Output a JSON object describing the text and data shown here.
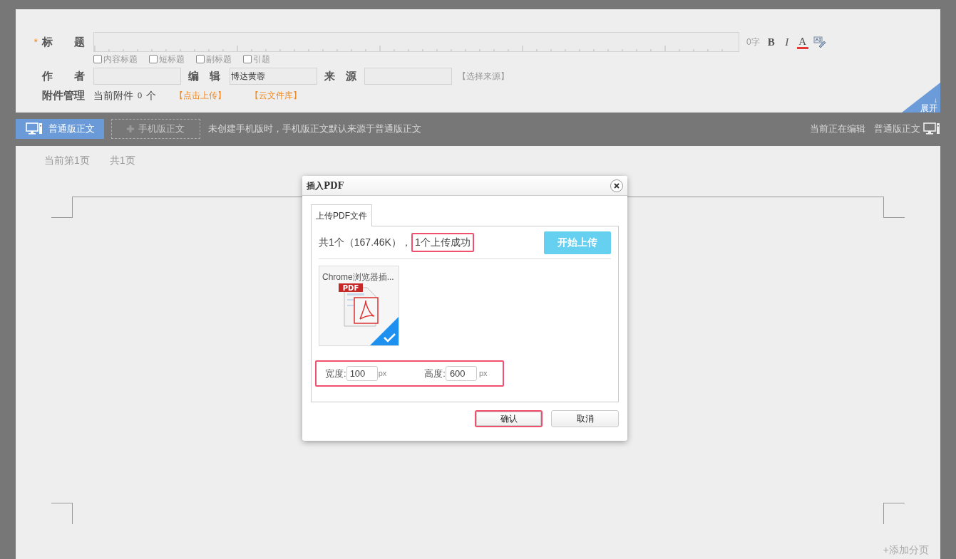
{
  "form": {
    "required_mark": "*",
    "title_label": "标　　题",
    "title_counter": "0字",
    "format_buttons": [
      {
        "label": "B",
        "kind": "bold"
      },
      {
        "label": "I",
        "kind": "italic"
      },
      {
        "label": "A",
        "kind": "color"
      },
      {
        "kind": "spellcheck"
      }
    ],
    "title_options": [
      {
        "label": "内容标题",
        "checked": false
      },
      {
        "label": "短标题",
        "checked": false
      },
      {
        "label": "副标题",
        "checked": false
      },
      {
        "label": "引题",
        "checked": false
      }
    ],
    "author_label": "作　　者",
    "editor_label": "编　辑",
    "editor_value": "博达黄蓉",
    "source_label": "来　源",
    "choose_source": "【选择来源】",
    "attachments_label": "附件管理",
    "attachments_text": "当前附件",
    "attachments_count": "0",
    "attachments_unit": "个",
    "upload_link": "【点击上传】",
    "cloud_link": "【云文件库】",
    "expand": {
      "arrow": "↓",
      "label": "展开"
    }
  },
  "toolbar": {
    "tabs": [
      {
        "label": "普通版正文",
        "selected": true
      },
      {
        "label": "手机版正文",
        "selected": false
      }
    ],
    "hint": "未创建手机版时，手机版正文默认来源于普通版正文",
    "status": "当前正在编辑",
    "current": "普通版正文"
  },
  "editor": {
    "page_current": "当前第1页",
    "page_total": "共1页",
    "add_page": "+添加分页"
  },
  "dialog": {
    "title": "插入PDF",
    "tabs": [
      {
        "label": "上传PDF文件",
        "selected": true
      }
    ],
    "summary": "共1个（167.46K），",
    "upload_status": "1个上传成功",
    "start_button": "开始上传",
    "files": [
      {
        "name": "Chrome浏览器插...",
        "badge": "PDF",
        "checked": true
      }
    ],
    "width_label": "宽度:",
    "width_value": "100",
    "width_unit": "px",
    "height_label": "高度:",
    "height_value": "600",
    "height_unit": "px",
    "buttons": [
      "确认",
      "取消"
    ]
  }
}
